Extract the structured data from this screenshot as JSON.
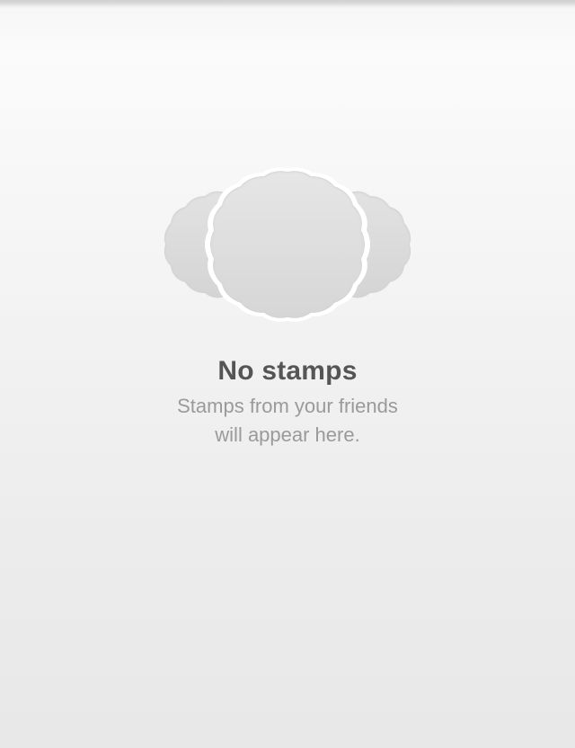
{
  "empty_state": {
    "icon": "stamps-icon",
    "title": "No stamps",
    "subtitle_line1": "Stamps from your friends",
    "subtitle_line2": "will appear here."
  },
  "colors": {
    "title": "#555555",
    "subtitle": "#9a9a9a",
    "stamp_fill": "#dcdcdc"
  }
}
